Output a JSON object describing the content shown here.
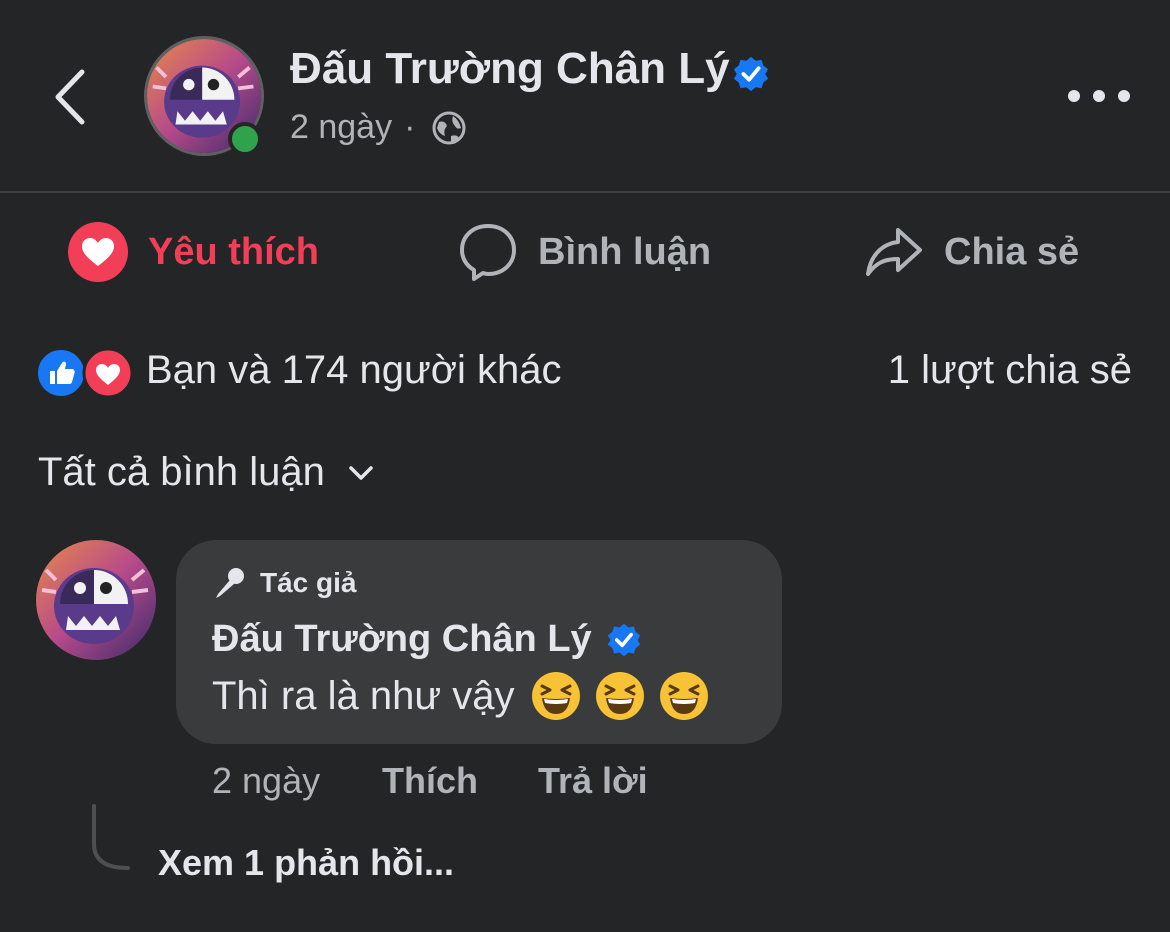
{
  "header": {
    "page_name": "Đấu Trường Chân Lý",
    "time": "2 ngày",
    "separator": "·",
    "privacy_icon": "globe-icon",
    "back_icon": "chevron-left-icon",
    "more_icon": "more-horizontal-icon"
  },
  "actions": {
    "love_label": "Yêu thích",
    "comment_label": "Bình luận",
    "share_label": "Chia sẻ"
  },
  "reactions": {
    "summary": "Bạn và 174 người khác",
    "share_count": "1 lượt chia sẻ"
  },
  "comments_filter": {
    "label": "Tất cả bình luận"
  },
  "comment": {
    "badge": "Tác giả",
    "author": "Đấu Trường Chân Lý",
    "text": "Thì ra là như vậy",
    "emoji": [
      "laughing-face",
      "laughing-face",
      "laughing-face"
    ],
    "time": "2 ngày",
    "like_label": "Thích",
    "reply_label": "Trả lời",
    "view_replies": "Xem 1 phản hồi..."
  },
  "colors": {
    "background": "#242526",
    "love": "#f33e58",
    "like_blue": "#1877f2",
    "online": "#31a24c",
    "bubble": "#3a3b3c"
  }
}
